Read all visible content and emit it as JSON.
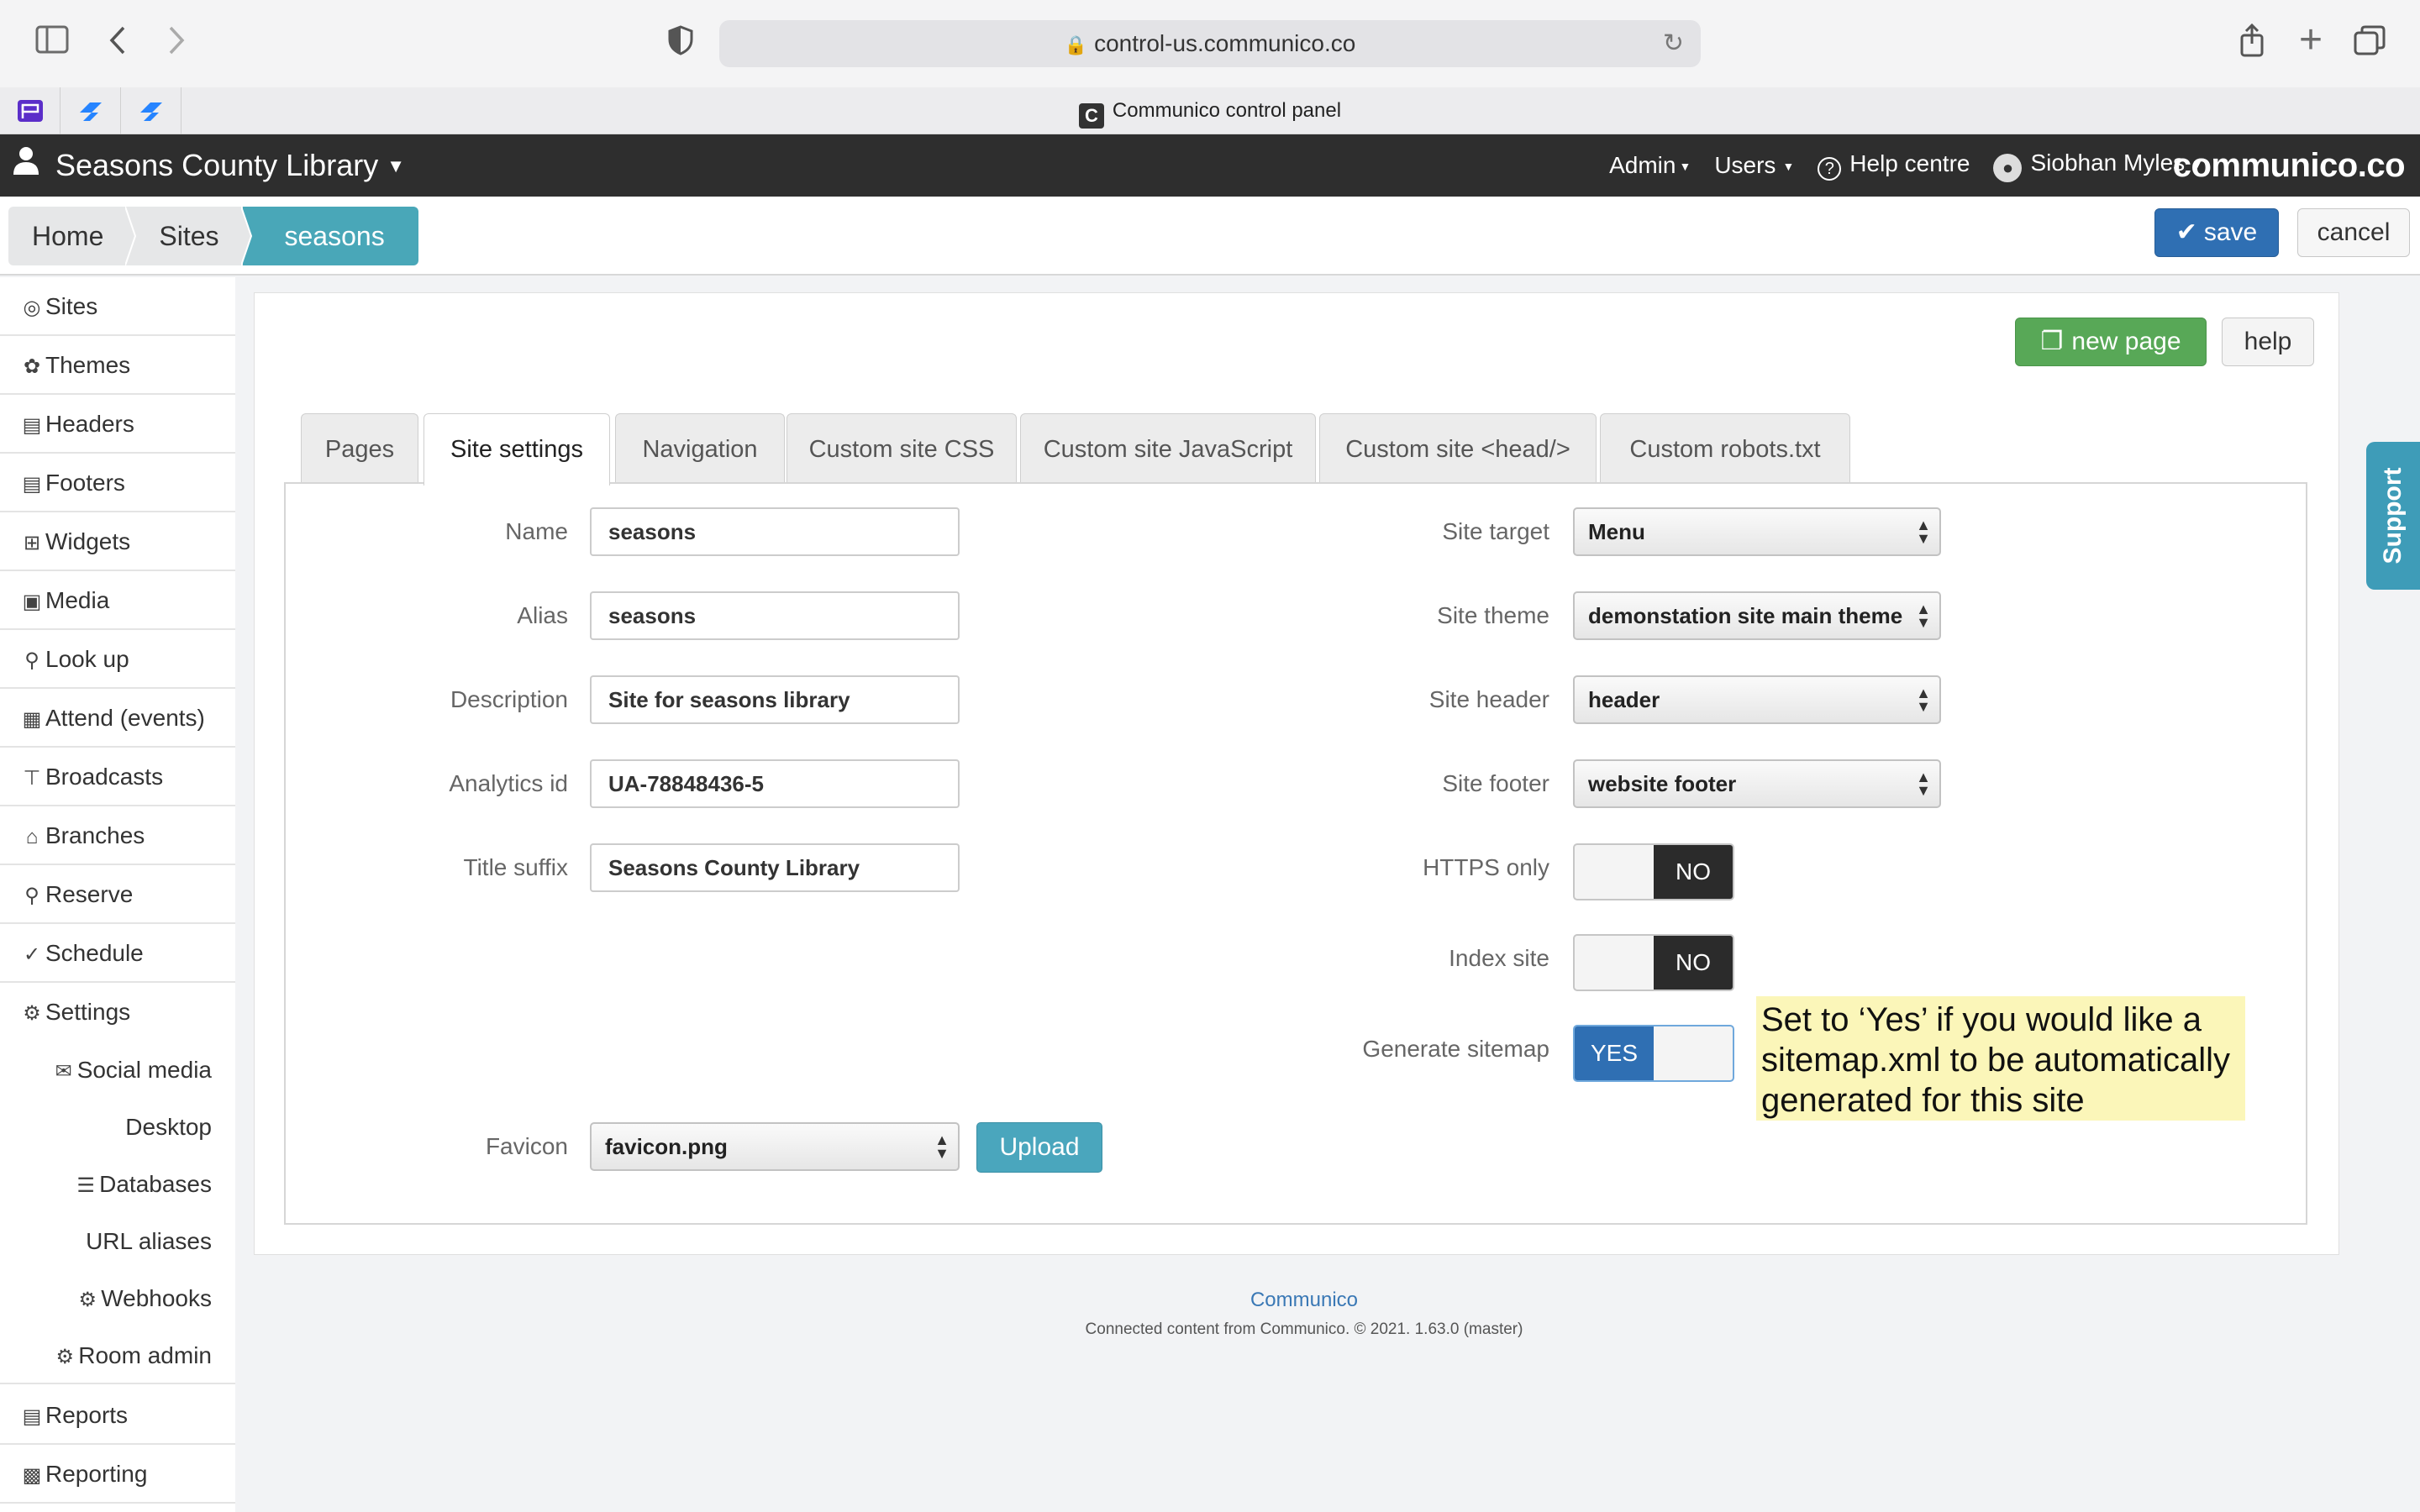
{
  "browser": {
    "url": "control-us.communico.co",
    "tab_title": "Communico control panel",
    "favicon_letter": "C"
  },
  "topbar": {
    "library": "Seasons County Library",
    "admin": "Admin",
    "users": "Users",
    "help": "Help centre",
    "user": "Siobhan Myles",
    "brand": "communico.co"
  },
  "breadcrumb": [
    "Home",
    "Sites",
    "seasons"
  ],
  "actions": {
    "save": "save",
    "cancel": "cancel",
    "new_page": "new page",
    "help": "help"
  },
  "sidebar": {
    "items": [
      {
        "label": "Sites",
        "icon": "sites-icon"
      },
      {
        "label": "Themes",
        "icon": "palette-icon"
      },
      {
        "label": "Headers",
        "icon": "header-icon"
      },
      {
        "label": "Footers",
        "icon": "footer-icon"
      },
      {
        "label": "Widgets",
        "icon": "widgets-icon"
      },
      {
        "label": "Media",
        "icon": "image-icon"
      },
      {
        "label": "Look up",
        "icon": "search-icon"
      },
      {
        "label": "Attend (events)",
        "icon": "calendar-icon"
      },
      {
        "label": "Broadcasts",
        "icon": "broadcast-icon"
      },
      {
        "label": "Branches",
        "icon": "building-icon"
      },
      {
        "label": "Reserve",
        "icon": "key-icon"
      },
      {
        "label": "Schedule",
        "icon": "check-circle-icon"
      },
      {
        "label": "Settings",
        "icon": "gear-icon"
      }
    ],
    "settings_children": [
      {
        "label": "Social media",
        "icon": "chat-icon"
      },
      {
        "label": "Desktop",
        "icon": ""
      },
      {
        "label": "Databases",
        "icon": "books-icon"
      },
      {
        "label": "URL aliases",
        "icon": ""
      },
      {
        "label": "Webhooks",
        "icon": "gear-icon"
      },
      {
        "label": "Room admin",
        "icon": "gear-icon"
      }
    ],
    "bottom": [
      {
        "label": "Reports",
        "icon": "report-icon"
      },
      {
        "label": "Reporting",
        "icon": "chart-icon"
      }
    ]
  },
  "tabs": [
    "Pages",
    "Site settings",
    "Navigation",
    "Custom site CSS",
    "Custom site JavaScript",
    "Custom site <head/>",
    "Custom robots.txt"
  ],
  "form_left": {
    "name": {
      "label": "Name",
      "value": "seasons"
    },
    "alias": {
      "label": "Alias",
      "value": "seasons"
    },
    "description": {
      "label": "Description",
      "value": "Site for seasons library"
    },
    "analytics": {
      "label": "Analytics id",
      "value": "UA-78848436-5"
    },
    "title_suffix": {
      "label": "Title suffix",
      "value": "Seasons County Library"
    },
    "favicon": {
      "label": "Favicon",
      "value": "favicon.png",
      "upload": "Upload"
    }
  },
  "form_right": {
    "site_target": {
      "label": "Site target",
      "value": "Menu"
    },
    "site_theme": {
      "label": "Site theme",
      "value": "demonstation site main theme"
    },
    "site_header": {
      "label": "Site header",
      "value": "header"
    },
    "site_footer": {
      "label": "Site footer",
      "value": "website footer"
    },
    "https_only": {
      "label": "HTTPS only",
      "value": "NO"
    },
    "index_site": {
      "label": "Index site",
      "value": "NO"
    },
    "generate_sitemap": {
      "label": "Generate sitemap",
      "value": "YES"
    }
  },
  "note": "Set to ‘Yes’ if you would like a sitemap.xml to be automatically generated for this site",
  "footer": {
    "link": "Communico",
    "text": "Connected content from Communico. © 2021. 1.63.0 (master)"
  },
  "support": "Support"
}
